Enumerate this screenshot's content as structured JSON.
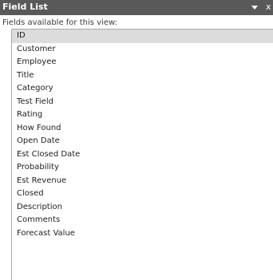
{
  "header": {
    "title": "Field List",
    "menu_icon": "chevron-down-icon",
    "close_icon": "close-icon",
    "close_glyph": "x"
  },
  "subtitle": "Fields available for this view:",
  "fields": [
    {
      "label": "ID",
      "selected": true
    },
    {
      "label": "Customer",
      "selected": false
    },
    {
      "label": "Employee",
      "selected": false
    },
    {
      "label": "Title",
      "selected": false
    },
    {
      "label": "Category",
      "selected": false
    },
    {
      "label": "Test Field",
      "selected": false
    },
    {
      "label": "Rating",
      "selected": false
    },
    {
      "label": "How Found",
      "selected": false
    },
    {
      "label": "Open Date",
      "selected": false
    },
    {
      "label": "Est Closed Date",
      "selected": false
    },
    {
      "label": "Probability",
      "selected": false
    },
    {
      "label": "Est Revenue",
      "selected": false
    },
    {
      "label": "Closed",
      "selected": false
    },
    {
      "label": "Description",
      "selected": false
    },
    {
      "label": "Comments",
      "selected": false
    },
    {
      "label": "Forecast Value",
      "selected": false
    }
  ],
  "colors": {
    "titlebar": "#595959",
    "selected_row": "#dcdcdc",
    "list_border": "#a8a8a8"
  }
}
